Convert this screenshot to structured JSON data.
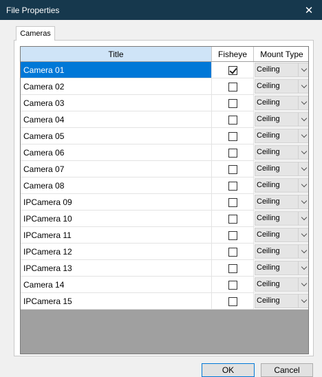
{
  "window": {
    "title": "File Properties",
    "close_glyph": "✕"
  },
  "tabs": [
    {
      "label": "Cameras",
      "active": true
    }
  ],
  "grid": {
    "columns": [
      "Title",
      "Fisheye",
      "Mount Type"
    ],
    "rows": [
      {
        "title": "Camera 01",
        "fisheye": true,
        "mount": "Ceiling",
        "selected": true
      },
      {
        "title": "Camera 02",
        "fisheye": false,
        "mount": "Ceiling"
      },
      {
        "title": "Camera 03",
        "fisheye": false,
        "mount": "Ceiling"
      },
      {
        "title": "Camera 04",
        "fisheye": false,
        "mount": "Ceiling"
      },
      {
        "title": "Camera 05",
        "fisheye": false,
        "mount": "Ceiling"
      },
      {
        "title": "Camera 06",
        "fisheye": false,
        "mount": "Ceiling"
      },
      {
        "title": "Camera 07",
        "fisheye": false,
        "mount": "Ceiling"
      },
      {
        "title": "Camera 08",
        "fisheye": false,
        "mount": "Ceiling"
      },
      {
        "title": "IPCamera 09",
        "fisheye": false,
        "mount": "Ceiling"
      },
      {
        "title": "IPCamera 10",
        "fisheye": false,
        "mount": "Ceiling"
      },
      {
        "title": "IPCamera 11",
        "fisheye": false,
        "mount": "Ceiling"
      },
      {
        "title": "IPCamera 12",
        "fisheye": false,
        "mount": "Ceiling"
      },
      {
        "title": "IPCamera 13",
        "fisheye": false,
        "mount": "Ceiling"
      },
      {
        "title": "Camera 14",
        "fisheye": false,
        "mount": "Ceiling"
      },
      {
        "title": "IPCamera 15",
        "fisheye": false,
        "mount": "Ceiling"
      }
    ]
  },
  "buttons": {
    "ok_label": "OK",
    "cancel_label": "Cancel"
  },
  "colors": {
    "titlebar": "#16384d",
    "selection": "#0078d7",
    "header_title_bg": "#cfe4f7",
    "empty_grid": "#a0a0a0"
  }
}
